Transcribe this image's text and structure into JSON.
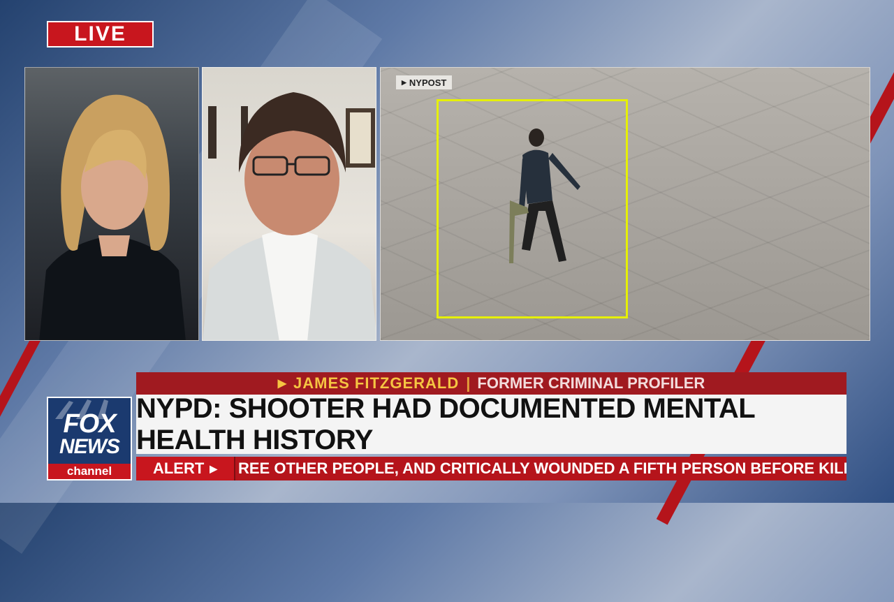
{
  "live_badge": "LIVE",
  "video": {
    "source_tag": "NYPOST"
  },
  "lower_third": {
    "name": "JAMES FITZGERALD",
    "title": "FORMER CRIMINAL PROFILER",
    "headline": "NYPD: SHOOTER HAD DOCUMENTED MENTAL HEALTH HISTORY"
  },
  "alert": {
    "label": "ALERT",
    "ticker": "REE OTHER PEOPLE, AND CRITICALLY WOUNDED A FIFTH PERSON BEFORE KILLING"
  },
  "logo": {
    "line1": "FOX",
    "line2": "NEWS",
    "line3": "channel"
  },
  "colors": {
    "brand_red": "#c8161e",
    "brand_blue": "#1b3a6f",
    "name_gold": "#f5c542",
    "target_box": "#e6f000"
  }
}
